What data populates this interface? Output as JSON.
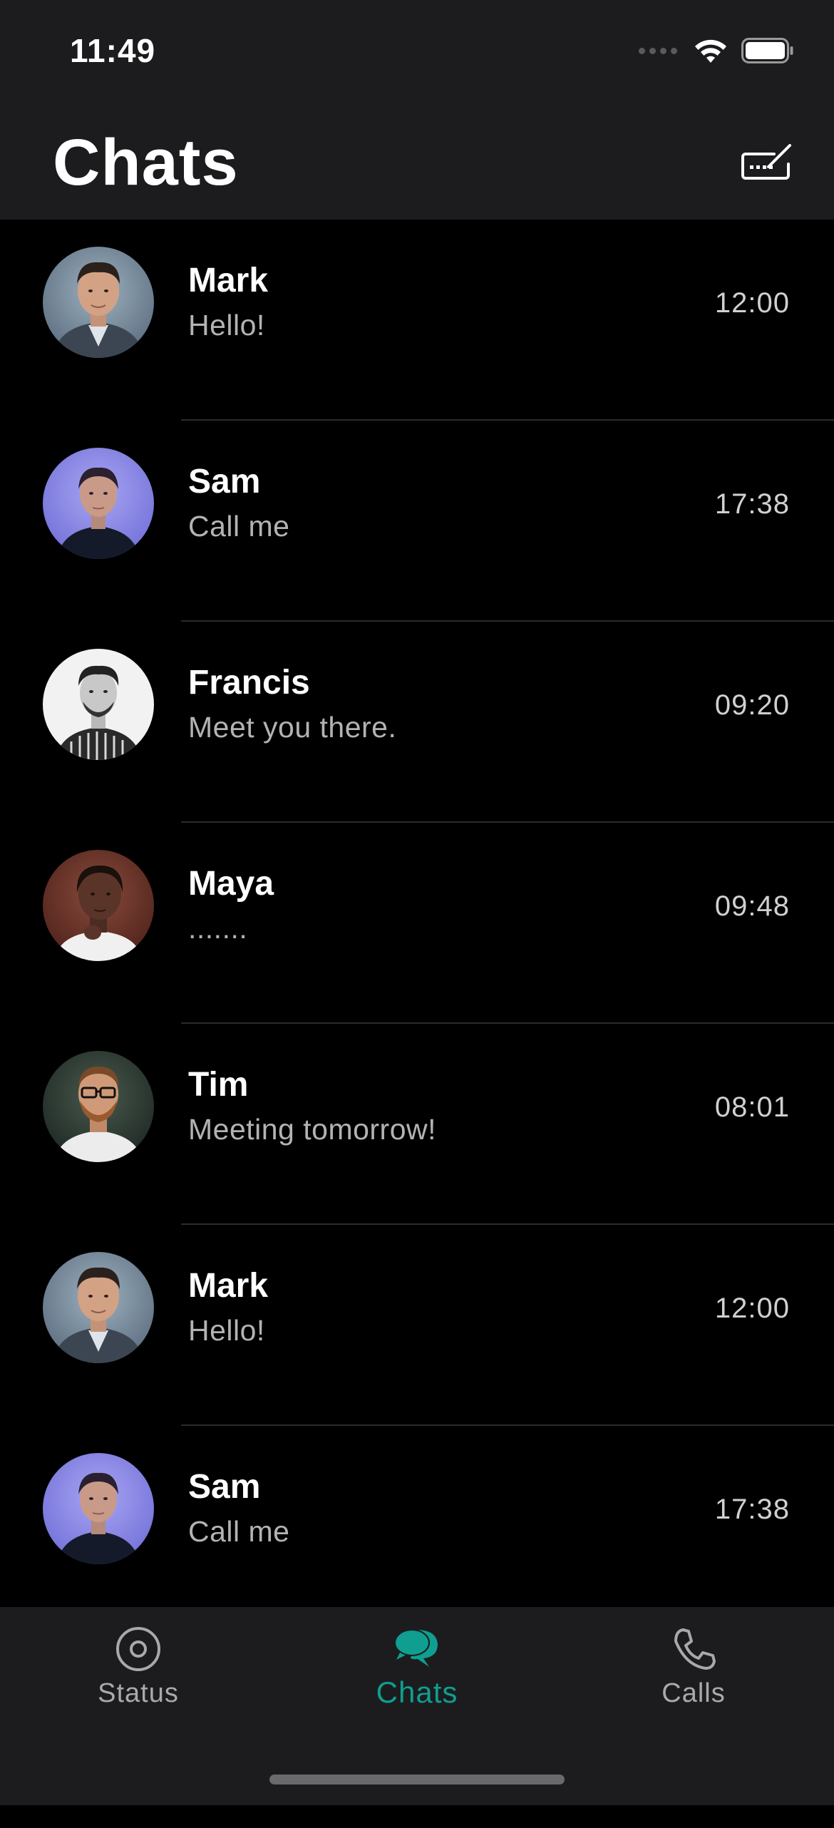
{
  "status_bar": {
    "time": "11:49",
    "icons": [
      "signal-dots-icon",
      "wifi-icon",
      "battery-icon"
    ]
  },
  "header": {
    "title": "Chats",
    "compose_icon": "compose-icon"
  },
  "chats": [
    {
      "name": "Mark",
      "message": "Hello!",
      "time": "12:00",
      "avatar": "person-avatar"
    },
    {
      "name": "Sam",
      "message": "Call me",
      "time": "17:38",
      "avatar": "person-avatar"
    },
    {
      "name": "Francis",
      "message": "Meet you there.",
      "time": "09:20",
      "avatar": "person-avatar"
    },
    {
      "name": "Maya",
      "message": ".......",
      "time": "09:48",
      "avatar": "person-avatar"
    },
    {
      "name": "Tim",
      "message": "Meeting tomorrow!",
      "time": "08:01",
      "avatar": "person-avatar"
    },
    {
      "name": "Mark",
      "message": "Hello!",
      "time": "12:00",
      "avatar": "person-avatar"
    },
    {
      "name": "Sam",
      "message": "Call me",
      "time": "17:38",
      "avatar": "person-avatar"
    }
  ],
  "tabs": [
    {
      "label": "Status",
      "icon": "status-icon",
      "active": false
    },
    {
      "label": "Chats",
      "icon": "chat-bubbles-icon",
      "active": true
    },
    {
      "label": "Calls",
      "icon": "phone-icon",
      "active": false
    }
  ],
  "colors": {
    "accent": "#0f9e8f",
    "background": "#000000",
    "bar_background": "#1c1c1e",
    "secondary_text": "#b3b3b3"
  }
}
